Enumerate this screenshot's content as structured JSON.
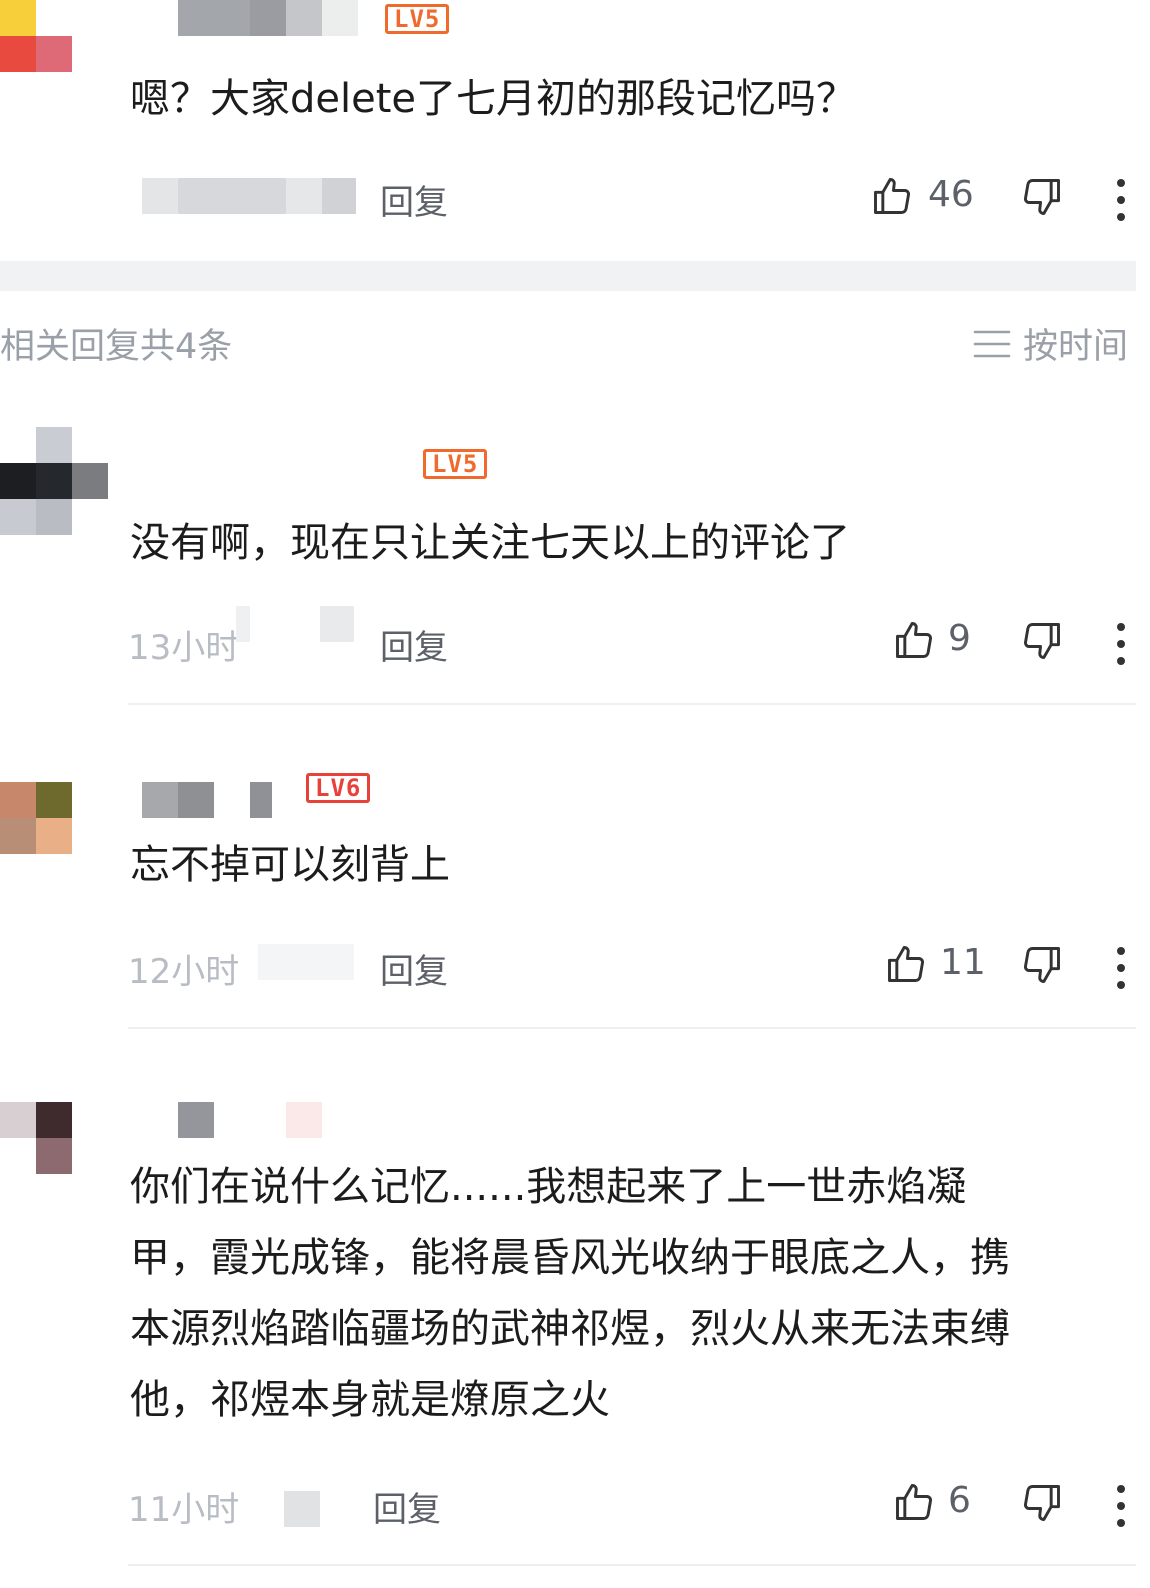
{
  "parent_comment": {
    "level": "LV5",
    "text": "嗯？大家delete了七月初的那段记忆吗？",
    "reply_label": "回复",
    "likes": "46"
  },
  "replies_header": {
    "title": "相关回复共4条",
    "sort_label": "按时间"
  },
  "replies": [
    {
      "level": "LV5",
      "text": "没有啊，现在只让关注七天以上的评论了",
      "time": "13小时",
      "reply_label": "回复",
      "likes": "9"
    },
    {
      "level": "LV6",
      "text": "忘不掉可以刻背上",
      "time": "12小时",
      "reply_label": "回复",
      "likes": "11"
    },
    {
      "text_lines": [
        "你们在说什么记忆......我想起来了上一世赤焰凝",
        "甲，霞光成锋，能将晨昏风光收纳于眼底之人，携",
        "本源烈焰踏临疆场的武神祁煜，烈火从来无法束缚",
        "他，祁煜本身就是燎原之火"
      ],
      "time": "11小时",
      "reply_label": "回复",
      "likes": "6"
    }
  ],
  "icons": {
    "like": "thumbs-up-icon",
    "dislike": "thumbs-down-icon",
    "more": "more-vertical-icon",
    "sort": "list-lines-icon"
  },
  "colors": {
    "lv5_badge": "#ef6a2c",
    "lv6_badge": "#e8413a",
    "muted_text": "#9aa0a8",
    "time_text": "#b8bcc4"
  }
}
